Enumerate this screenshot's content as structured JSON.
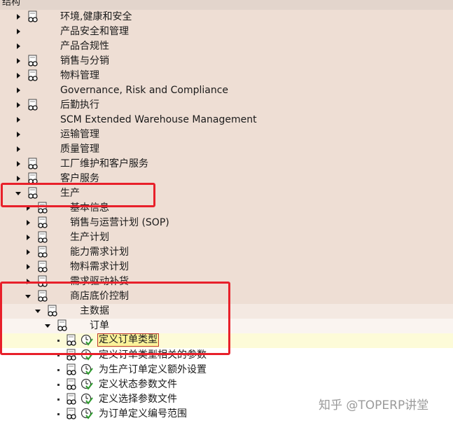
{
  "header": {
    "title": "结构"
  },
  "tree": [
    {
      "label": "环境,健康和安全",
      "expander": "right",
      "icon": "config-glasses-icon"
    },
    {
      "label": "产品安全和管理",
      "expander": "right",
      "icon": ""
    },
    {
      "label": "产品合规性",
      "expander": "right",
      "icon": ""
    },
    {
      "label": "销售与分销",
      "expander": "right",
      "icon": "config-glasses-icon"
    },
    {
      "label": "物料管理",
      "expander": "right",
      "icon": "config-glasses-icon"
    },
    {
      "label": "Governance, Risk and Compliance",
      "expander": "right",
      "icon": ""
    },
    {
      "label": "后勤执行",
      "expander": "right",
      "icon": "config-glasses-icon"
    },
    {
      "label": "SCM Extended Warehouse Management",
      "expander": "right",
      "icon": ""
    },
    {
      "label": "运输管理",
      "expander": "right",
      "icon": ""
    },
    {
      "label": "质量管理",
      "expander": "right",
      "icon": ""
    },
    {
      "label": "工厂维护和客户服务",
      "expander": "right",
      "icon": "config-glasses-icon"
    },
    {
      "label": "客户服务",
      "expander": "right",
      "icon": "config-glasses-icon"
    },
    {
      "label": "生产",
      "expander": "down",
      "icon": "config-glasses-icon"
    },
    {
      "label": "基本信息",
      "expander": "right",
      "icon": "config-glasses-icon"
    },
    {
      "label": "销售与运营计划 (SOP)",
      "expander": "right",
      "icon": "config-glasses-icon"
    },
    {
      "label": "生产计划",
      "expander": "right",
      "icon": "config-glasses-icon"
    },
    {
      "label": "能力需求计划",
      "expander": "right",
      "icon": "config-glasses-icon"
    },
    {
      "label": "物料需求计划",
      "expander": "right",
      "icon": "config-glasses-icon"
    },
    {
      "label": "需求驱动补货",
      "expander": "right",
      "icon": "config-glasses-icon"
    },
    {
      "label": "商店底价控制",
      "expander": "down",
      "icon": "config-glasses-icon"
    },
    {
      "label": "主数据",
      "expander": "down",
      "icon": "config-glasses-icon"
    },
    {
      "label": "订单",
      "expander": "down",
      "icon": "config-glasses-icon"
    },
    {
      "label": "定义订单类型",
      "expander": "leaf",
      "icon": "config-glasses-icon",
      "execute_icon": "clock-execute-icon"
    },
    {
      "label": "定义订单类型相关的参数",
      "expander": "leaf",
      "icon": "config-glasses-icon",
      "execute_icon": "clock-execute-icon"
    },
    {
      "label": "为生产订单定义额外设置",
      "expander": "leaf",
      "icon": "config-glasses-icon",
      "execute_icon": "clock-execute-icon"
    },
    {
      "label": "定义状态参数文件",
      "expander": "leaf",
      "icon": "config-glasses-icon",
      "execute_icon": "clock-execute-icon"
    },
    {
      "label": "定义选择参数文件",
      "expander": "leaf",
      "icon": "config-glasses-icon",
      "execute_icon": "clock-execute-icon"
    },
    {
      "label": "为订单定义编号范围",
      "expander": "leaf",
      "icon": "config-glasses-icon",
      "execute_icon": "clock-execute-icon"
    }
  ],
  "highlight_color": "#e8202a",
  "watermark": "知乎 @TOPERP讲堂"
}
